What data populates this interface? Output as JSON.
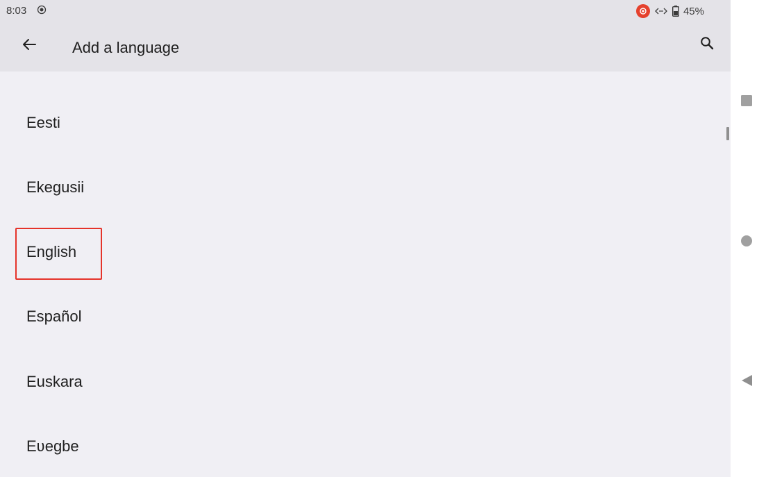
{
  "status_bar": {
    "time": "8:03",
    "battery_percent": "45%",
    "icons": [
      "screen-record-icon",
      "cast-icon",
      "data-saver-icon",
      "battery-icon"
    ]
  },
  "app_bar": {
    "title": "Add a language",
    "back_icon": "arrow-back-icon",
    "search_icon": "search-icon"
  },
  "languages": [
    {
      "label": "Eesti"
    },
    {
      "label": "Ekegusii"
    },
    {
      "label": "English",
      "highlighted": true
    },
    {
      "label": "Español"
    },
    {
      "label": "Euskara"
    },
    {
      "label": "Eʋegbe"
    }
  ],
  "colors": {
    "app_bar_bg": "#e4e3e8",
    "list_bg": "#f0eff4",
    "highlight_border": "#e5332a",
    "cast_badge": "#e5412d"
  },
  "nav_bar": {
    "buttons": [
      "recents-square-icon",
      "home-circle-icon",
      "back-triangle-icon"
    ]
  }
}
